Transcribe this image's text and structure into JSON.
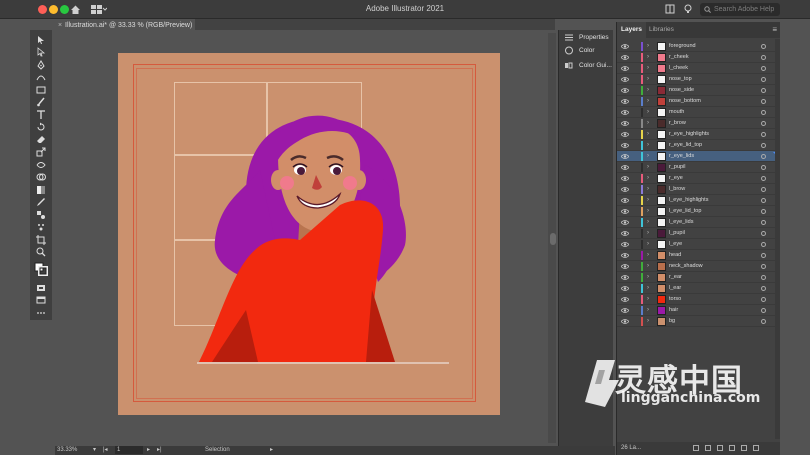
{
  "app": {
    "title": "Adobe Illustrator 2021",
    "search_placeholder": "Search Adobe Help"
  },
  "document": {
    "tab_label": "Illustration.ai* @ 33.33 % (RGB/Preview)"
  },
  "colors": {
    "artboard": "#cb916e",
    "hair": "#9b19a8",
    "torso": "#f2290f",
    "skin": "#d28e69",
    "selection_row": "#46607f"
  },
  "toolbar": {
    "tools": [
      "selection-tool-icon",
      "direct-selection-tool-icon",
      "pen-tool-icon",
      "curvature-tool-icon",
      "rectangle-tool-icon",
      "paintbrush-tool-icon",
      "type-tool-icon",
      "rotate-tool-icon",
      "eraser-tool-icon",
      "scale-tool-icon",
      "width-tool-icon",
      "shape-builder-tool-icon",
      "gradient-tool-icon",
      "eyedropper-tool-icon",
      "blend-tool-icon",
      "symbol-sprayer-tool-icon",
      "artboard-tool-icon",
      "zoom-tool-icon",
      "fill-stroke-icon",
      "draw-mode-icon",
      "screen-mode-icon",
      "more-tools-icon"
    ]
  },
  "side_panel": {
    "items": [
      {
        "label": "Properties",
        "icon": "properties-icon"
      },
      {
        "label": "Color",
        "icon": "color-icon"
      },
      {
        "label": "Color Gui...",
        "icon": "color-guide-icon"
      }
    ]
  },
  "layers_panel": {
    "tabs": [
      {
        "label": "Layers",
        "active": true
      },
      {
        "label": "Libraries",
        "active": false
      }
    ],
    "layers": [
      {
        "name": "foreground",
        "color": "#7a4fd0",
        "thumb": "#f4f4f4",
        "selected": false
      },
      {
        "name": "r_cheek",
        "color": "#e75b7b",
        "thumb": "#f07a8c",
        "selected": false
      },
      {
        "name": "l_cheek",
        "color": "#e75b7b",
        "thumb": "#f07a8c",
        "selected": false
      },
      {
        "name": "nose_top",
        "color": "#e75b7b",
        "thumb": "#f4f4f4",
        "selected": false
      },
      {
        "name": "nose_side",
        "color": "#3fae3a",
        "thumb": "#8a2a36",
        "selected": false
      },
      {
        "name": "nose_bottom",
        "color": "#5a7ecb",
        "thumb": "#c0403a",
        "selected": false
      },
      {
        "name": "mouth",
        "color": "#2d2d2d",
        "thumb": "#f4f4f4",
        "selected": false
      },
      {
        "name": "r_brow",
        "color": "#888888",
        "thumb": "#4a2b2b",
        "selected": false
      },
      {
        "name": "r_eye_highlights",
        "color": "#e6d44a",
        "thumb": "#f4f4f4",
        "selected": false
      },
      {
        "name": "r_eye_lid_top",
        "color": "#3fc4d8",
        "thumb": "#f4f4f4",
        "selected": false
      },
      {
        "name": "r_eye_lids",
        "color": "#3fc4d8",
        "thumb": "#f4f4f4",
        "selected": true
      },
      {
        "name": "r_pupil",
        "color": "#2d2d2d",
        "thumb": "#4a1a3a",
        "selected": false
      },
      {
        "name": "r_eye",
        "color": "#e75b7b",
        "thumb": "#f4f4f4",
        "selected": false
      },
      {
        "name": "l_brow",
        "color": "#8a7ad8",
        "thumb": "#4a2b2b",
        "selected": false
      },
      {
        "name": "l_eye_highlights",
        "color": "#e6d44a",
        "thumb": "#f4f4f4",
        "selected": false
      },
      {
        "name": "l_eye_lid_top",
        "color": "#e0a060",
        "thumb": "#f4f4f4",
        "selected": false
      },
      {
        "name": "l_eye_lids",
        "color": "#3fc4d8",
        "thumb": "#f4f4f4",
        "selected": false
      },
      {
        "name": "l_pupil",
        "color": "#2d2d2d",
        "thumb": "#4a1a3a",
        "selected": false
      },
      {
        "name": "l_eye",
        "color": "#2d2d2d",
        "thumb": "#f4f4f4",
        "selected": false
      },
      {
        "name": "head",
        "color": "#9b19a8",
        "thumb": "#d28e69",
        "selected": false
      },
      {
        "name": "neck_shadow",
        "color": "#3fae3a",
        "thumb": "#b86f4c",
        "selected": false
      },
      {
        "name": "r_ear",
        "color": "#3fae3a",
        "thumb": "#d28e69",
        "selected": false
      },
      {
        "name": "l_ear",
        "color": "#3fc4d8",
        "thumb": "#d28e69",
        "selected": false
      },
      {
        "name": "torso",
        "color": "#e75b7b",
        "thumb": "#f2290f",
        "selected": false
      },
      {
        "name": "hair",
        "color": "#5a7ecb",
        "thumb": "#9b19a8",
        "selected": false
      },
      {
        "name": "bg",
        "color": "#d25050",
        "thumb": "#cb916e",
        "selected": false
      }
    ],
    "footer_count": "26 La..."
  },
  "status_bar": {
    "zoom": "33.33%",
    "artboard_nav": "1",
    "tool": "Selection"
  },
  "watermark": {
    "brand": "灵感中国",
    "url": "lingganchina.com"
  }
}
